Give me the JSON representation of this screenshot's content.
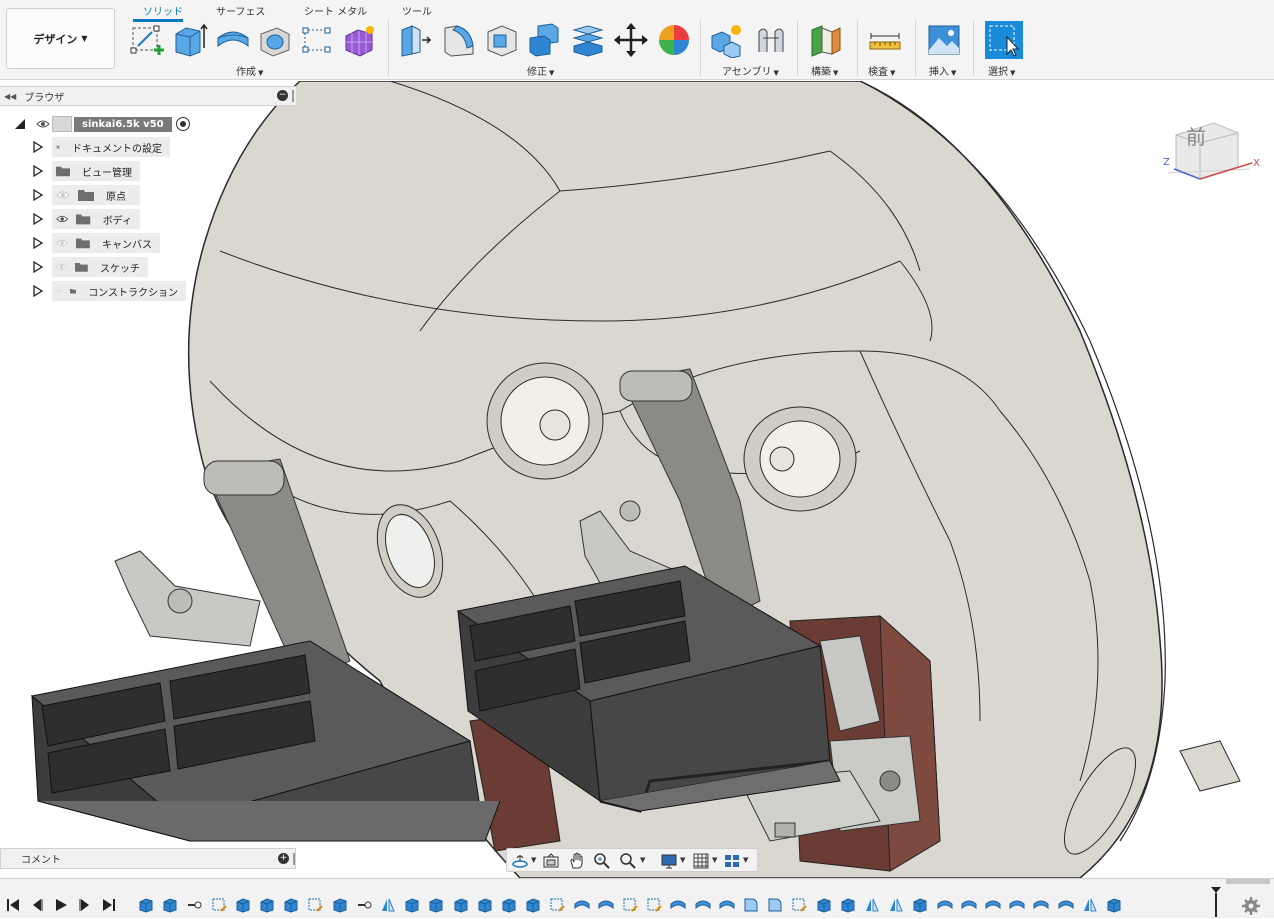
{
  "workspace_button": {
    "label": "デザイン"
  },
  "tabs": [
    {
      "label": "ソリッド",
      "active": true
    },
    {
      "label": "サーフェス",
      "active": false
    },
    {
      "label": "シート メタル",
      "active": false
    },
    {
      "label": "ツール",
      "active": false
    }
  ],
  "toolbar_groups": [
    {
      "label": "作成",
      "icons": [
        "create-sketch-icon",
        "extrude-icon",
        "revolve-icon",
        "hole-icon",
        "pattern-icon",
        "form-icon"
      ]
    },
    {
      "label": "修正",
      "icons": [
        "press-pull-icon",
        "fillet-icon",
        "shell-icon",
        "combine-icon",
        "split-body-icon",
        "move-icon",
        "appearance-icon"
      ]
    },
    {
      "label": "アセンブリ",
      "icons": [
        "new-component-icon",
        "joint-icon"
      ]
    },
    {
      "label": "構築",
      "icons": [
        "construction-plane-icon"
      ]
    },
    {
      "label": "検査",
      "icons": [
        "measure-icon"
      ]
    },
    {
      "label": "挿入",
      "icons": [
        "insert-image-icon"
      ]
    },
    {
      "label": "選択",
      "icons": [
        "select-icon"
      ]
    }
  ],
  "browser": {
    "title": "ブラウザ",
    "root": {
      "label": "sinkai6.5k v50"
    },
    "items": [
      {
        "label": "ドキュメントの設定",
        "icon": "gear-icon",
        "eye": "none"
      },
      {
        "label": "ビュー管理",
        "icon": "folder-icon",
        "eye": "none"
      },
      {
        "label": "原点",
        "icon": "folder-icon",
        "eye": "hidden"
      },
      {
        "label": "ボディ",
        "icon": "folder-icon",
        "eye": "visible"
      },
      {
        "label": "キャンバス",
        "icon": "folder-icon",
        "eye": "hidden"
      },
      {
        "label": "スケッチ",
        "icon": "folder-icon",
        "eye": "hidden"
      },
      {
        "label": "コンストラクション",
        "icon": "folder-icon",
        "eye": "hidden"
      }
    ]
  },
  "viewcube": {
    "face": "前",
    "axis_z": "Z",
    "axis_x": "X"
  },
  "comments": {
    "title": "コメント"
  },
  "navbar": {
    "icons": [
      "orbit-icon",
      "look-at-icon",
      "pan-icon",
      "zoom-icon",
      "fit-icon",
      "display-settings-icon",
      "grid-icon",
      "viewports-icon"
    ]
  },
  "timeline": {
    "controls": [
      "skip-start-icon",
      "step-back-icon",
      "play-icon",
      "step-forward-icon",
      "skip-end-icon"
    ],
    "features": [
      "extrude",
      "extrude",
      "joint",
      "sketch",
      "extrude",
      "extrude",
      "extrude",
      "sketch",
      "extrude",
      "joint",
      "mirror",
      "extrude",
      "extrude",
      "extrude",
      "extrude",
      "extrude",
      "extrude",
      "sketch",
      "revolve",
      "revolve",
      "sketch",
      "sketch",
      "revolve",
      "revolve",
      "revolve",
      "fillet",
      "fillet",
      "sketch",
      "extrude",
      "extrude",
      "mirror",
      "mirror",
      "extrude",
      "revolve",
      "revolve",
      "revolve",
      "revolve",
      "revolve",
      "revolve",
      "mirror",
      "component"
    ]
  },
  "colors": {
    "accent": "#0a7ac0",
    "shell": "#d9d7cf",
    "shell_edge": "#2a2a2a",
    "dark_box": "#444444",
    "brown_block": "#6b3c33",
    "frame_gray": "#8a8a86"
  }
}
